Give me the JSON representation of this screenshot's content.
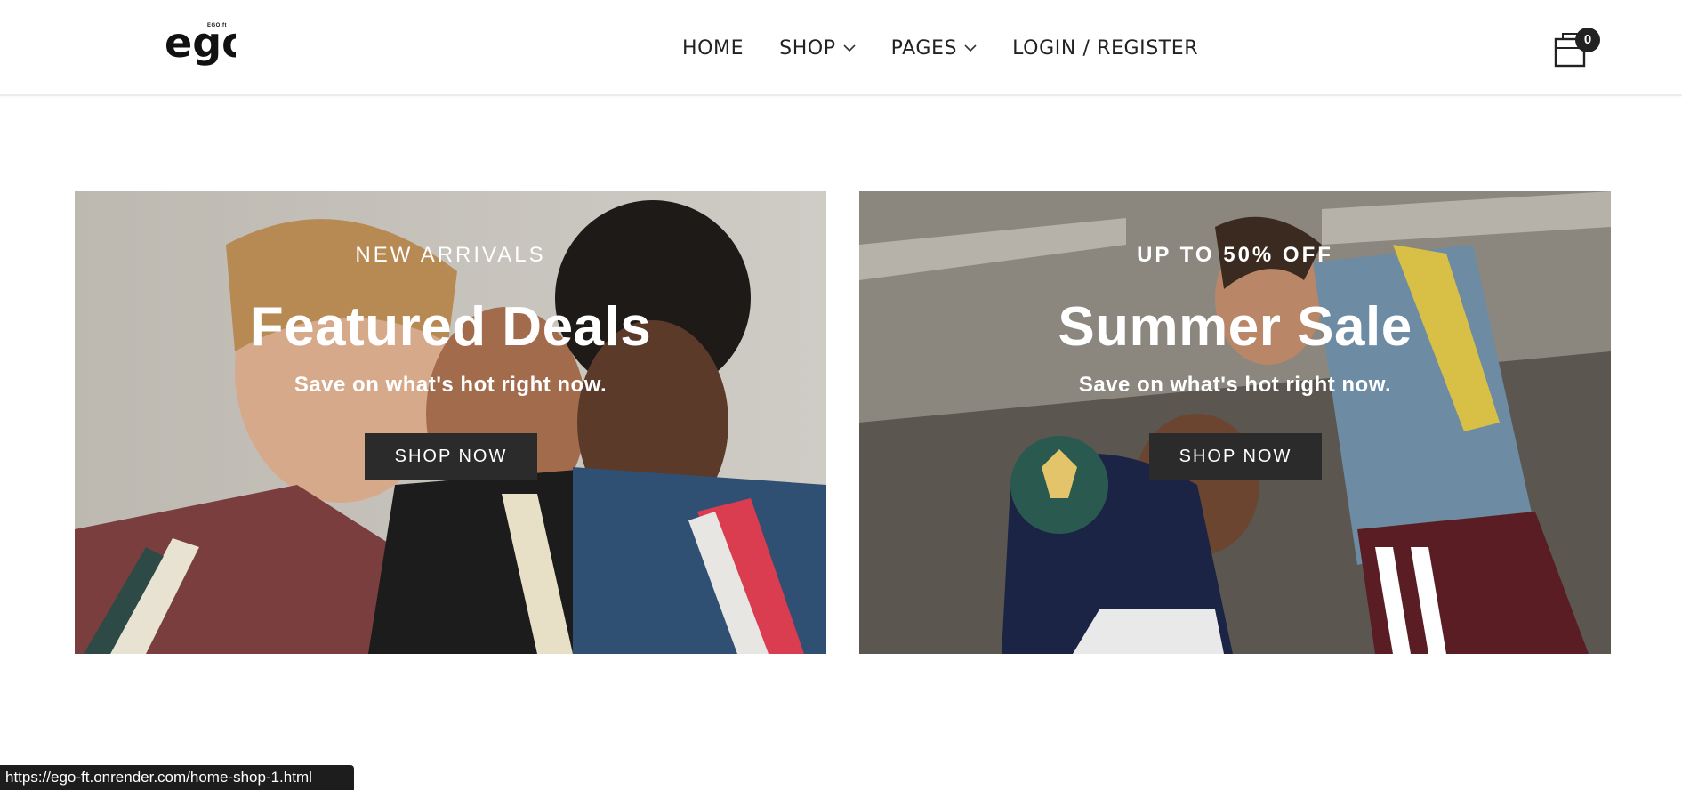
{
  "header": {
    "logo_text": "ego",
    "logo_sub": "EGO.ft",
    "nav": [
      {
        "label": "HOME",
        "has_dropdown": false
      },
      {
        "label": "SHOP",
        "has_dropdown": true
      },
      {
        "label": "PAGES",
        "has_dropdown": true
      },
      {
        "label": "LOGIN / REGISTER",
        "has_dropdown": false
      }
    ],
    "cart": {
      "icon": "shopping-bag-icon",
      "count": "0"
    }
  },
  "banners": [
    {
      "eyebrow": "NEW ARRIVALS",
      "headline": "Featured Deals",
      "subtitle": "Save on what's hot right now.",
      "button": "SHOP NOW"
    },
    {
      "eyebrow": "UP TO 50% OFF",
      "headline": "Summer Sale",
      "subtitle": "Save on what's hot right now.",
      "button": "SHOP NOW"
    }
  ],
  "status_bar": {
    "url": "https://ego-ft.onrender.com/home-shop-1.html"
  },
  "colors": {
    "button_bg": "#2b2b2b",
    "text_dark": "#222222",
    "banner_text": "#ffffff"
  }
}
